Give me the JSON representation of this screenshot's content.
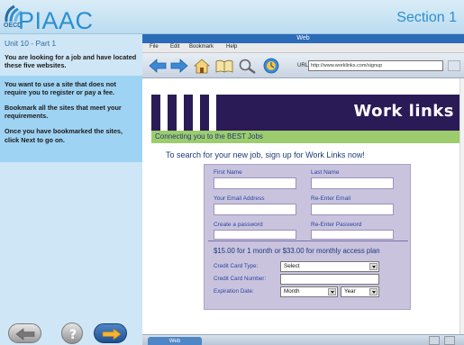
{
  "header": {
    "logo_small": "OECD",
    "logo_text": "PIAAC",
    "section": "Section 1"
  },
  "left_panel": {
    "unit": "Unit 10 - Part 1",
    "intro": "You are looking for a job and have located these five websites.",
    "instructions": [
      "You want to use a site that does not require you to register or pay a fee.",
      "Bookmark all the sites that meet your requirements.",
      "Once you have bookmarked the sites, click Next to go on."
    ],
    "nav": {
      "back_icon": "arrow-left-icon",
      "help_icon": "question-icon",
      "next_icon": "arrow-right-icon"
    }
  },
  "browser": {
    "window_title": "Web",
    "menu": [
      "File",
      "Edit",
      "Bookmark",
      "Help"
    ],
    "url_label": "URL:",
    "url": "http://www.worklinks.com/signup",
    "status_tab": "Web"
  },
  "site": {
    "brand": "Work links",
    "tagline": "Connecting you to the BEST Jobs",
    "lead": "To search for your new job, sign up for Work Links now!",
    "form": {
      "first_name": "First Name",
      "last_name": "Last Name",
      "email": "Your Email Address",
      "email_confirm": "Re-Enter Email",
      "password": "Create a password",
      "password_confirm": "Re-Enter Password",
      "price": "$15.00 for 1 month or $33.00 for monthly access plan",
      "cc_type_label": "Credit Card Type:",
      "cc_type_value": "Select",
      "cc_number_label": "Credit Card Number:",
      "exp_label": "Expiration Date:",
      "exp_month": "Month",
      "exp_year": "Year"
    }
  },
  "colors": {
    "accent": "#2b8fd0",
    "banner": "#2a1b57",
    "tagline_bar": "#9ccc6c",
    "form_bg": "#c9c3de"
  }
}
